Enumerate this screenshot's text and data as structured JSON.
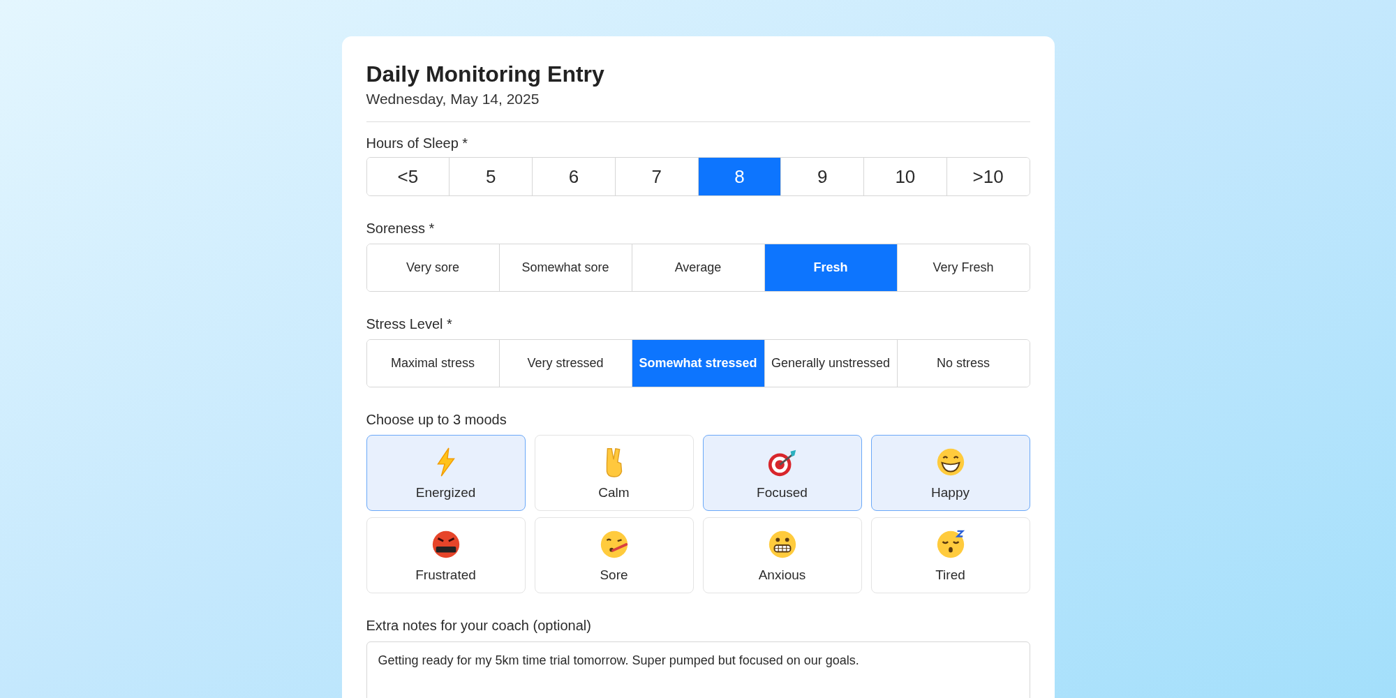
{
  "title": "Daily Monitoring Entry",
  "date": "Wednesday, May 14, 2025",
  "sleep": {
    "label": "Hours of Sleep *",
    "options": [
      {
        "label": "<5",
        "selected": false
      },
      {
        "label": "5",
        "selected": false
      },
      {
        "label": "6",
        "selected": false
      },
      {
        "label": "7",
        "selected": false
      },
      {
        "label": "8",
        "selected": true
      },
      {
        "label": "9",
        "selected": false
      },
      {
        "label": "10",
        "selected": false
      },
      {
        "label": ">10",
        "selected": false
      }
    ]
  },
  "soreness": {
    "label": "Soreness *",
    "options": [
      {
        "label": "Very sore",
        "selected": false
      },
      {
        "label": "Somewhat sore",
        "selected": false
      },
      {
        "label": "Average",
        "selected": false
      },
      {
        "label": "Fresh",
        "selected": true
      },
      {
        "label": "Very Fresh",
        "selected": false
      }
    ]
  },
  "stress": {
    "label": "Stress Level *",
    "options": [
      {
        "label": "Maximal stress",
        "selected": false
      },
      {
        "label": "Very stressed",
        "selected": false
      },
      {
        "label": "Somewhat stressed",
        "selected": true
      },
      {
        "label": "Generally unstressed",
        "selected": false
      },
      {
        "label": "No stress",
        "selected": false
      }
    ]
  },
  "moods": {
    "label": "Choose up to 3 moods",
    "items": [
      {
        "label": "Energized",
        "selected": true
      },
      {
        "label": "Calm",
        "selected": false
      },
      {
        "label": "Focused",
        "selected": true
      },
      {
        "label": "Happy",
        "selected": true
      },
      {
        "label": "Frustrated",
        "selected": false
      },
      {
        "label": "Sore",
        "selected": false
      },
      {
        "label": "Anxious",
        "selected": false
      },
      {
        "label": "Tired",
        "selected": false
      }
    ]
  },
  "notes": {
    "label": "Extra notes for your coach (optional)",
    "value": "Getting ready for my 5km time trial tomorrow. Super pumped but focused on our goals."
  }
}
